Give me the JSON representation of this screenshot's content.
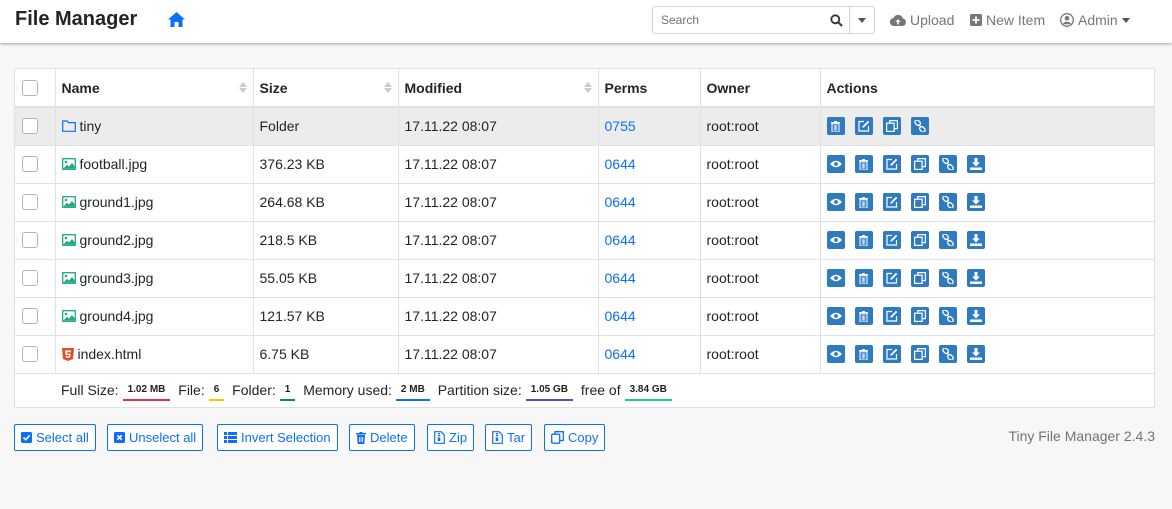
{
  "app": {
    "title": "File Manager"
  },
  "search": {
    "placeholder": "Search"
  },
  "nav": {
    "upload": "Upload",
    "new_item": "New Item",
    "admin": "Admin"
  },
  "table": {
    "headers": [
      "Name",
      "Size",
      "Modified",
      "Perms",
      "Owner",
      "Actions"
    ],
    "rows": [
      {
        "name": "tiny",
        "type": "folder",
        "size": "Folder",
        "modified": "17.11.22 08:07",
        "perms": "0755",
        "owner": "root:root"
      },
      {
        "name": "football.jpg",
        "type": "image",
        "size": "376.23 KB",
        "modified": "17.11.22 08:07",
        "perms": "0644",
        "owner": "root:root"
      },
      {
        "name": "ground1.jpg",
        "type": "image",
        "size": "264.68 KB",
        "modified": "17.11.22 08:07",
        "perms": "0644",
        "owner": "root:root"
      },
      {
        "name": "ground2.jpg",
        "type": "image",
        "size": "218.5 KB",
        "modified": "17.11.22 08:07",
        "perms": "0644",
        "owner": "root:root"
      },
      {
        "name": "ground3.jpg",
        "type": "image",
        "size": "55.05 KB",
        "modified": "17.11.22 08:07",
        "perms": "0644",
        "owner": "root:root"
      },
      {
        "name": "ground4.jpg",
        "type": "image",
        "size": "121.57 KB",
        "modified": "17.11.22 08:07",
        "perms": "0644",
        "owner": "root:root"
      },
      {
        "name": "index.html",
        "type": "html",
        "size": "6.75 KB",
        "modified": "17.11.22 08:07",
        "perms": "0644",
        "owner": "root:root"
      }
    ]
  },
  "footer": {
    "full_size_label": "Full Size:",
    "full_size": "1.02 MB",
    "file_label": "File:",
    "file_count": "6",
    "folder_label": "Folder:",
    "folder_count": "1",
    "memory_label": "Memory used:",
    "memory": "2 MB",
    "partition_label": "Partition size:",
    "partition": "1.05 GB",
    "free_label": "free of",
    "total": "3.84 GB"
  },
  "buttons": {
    "select_all": "Select all",
    "unselect_all": "Unselect all",
    "invert_selection": "Invert Selection",
    "delete": "Delete",
    "zip": "Zip",
    "tar": "Tar",
    "copy": "Copy"
  },
  "version": "Tiny File Manager 2.4.3",
  "colors": {
    "link": "#0d6efd",
    "action_button": "#2f7bc1",
    "badge_full_size": "#dc3545",
    "badge_file": "#ffc107",
    "badge_folder": "#198754",
    "badge_memory": "#0d6efd",
    "badge_partition": "#6f42c1",
    "badge_total": "#20c997"
  }
}
